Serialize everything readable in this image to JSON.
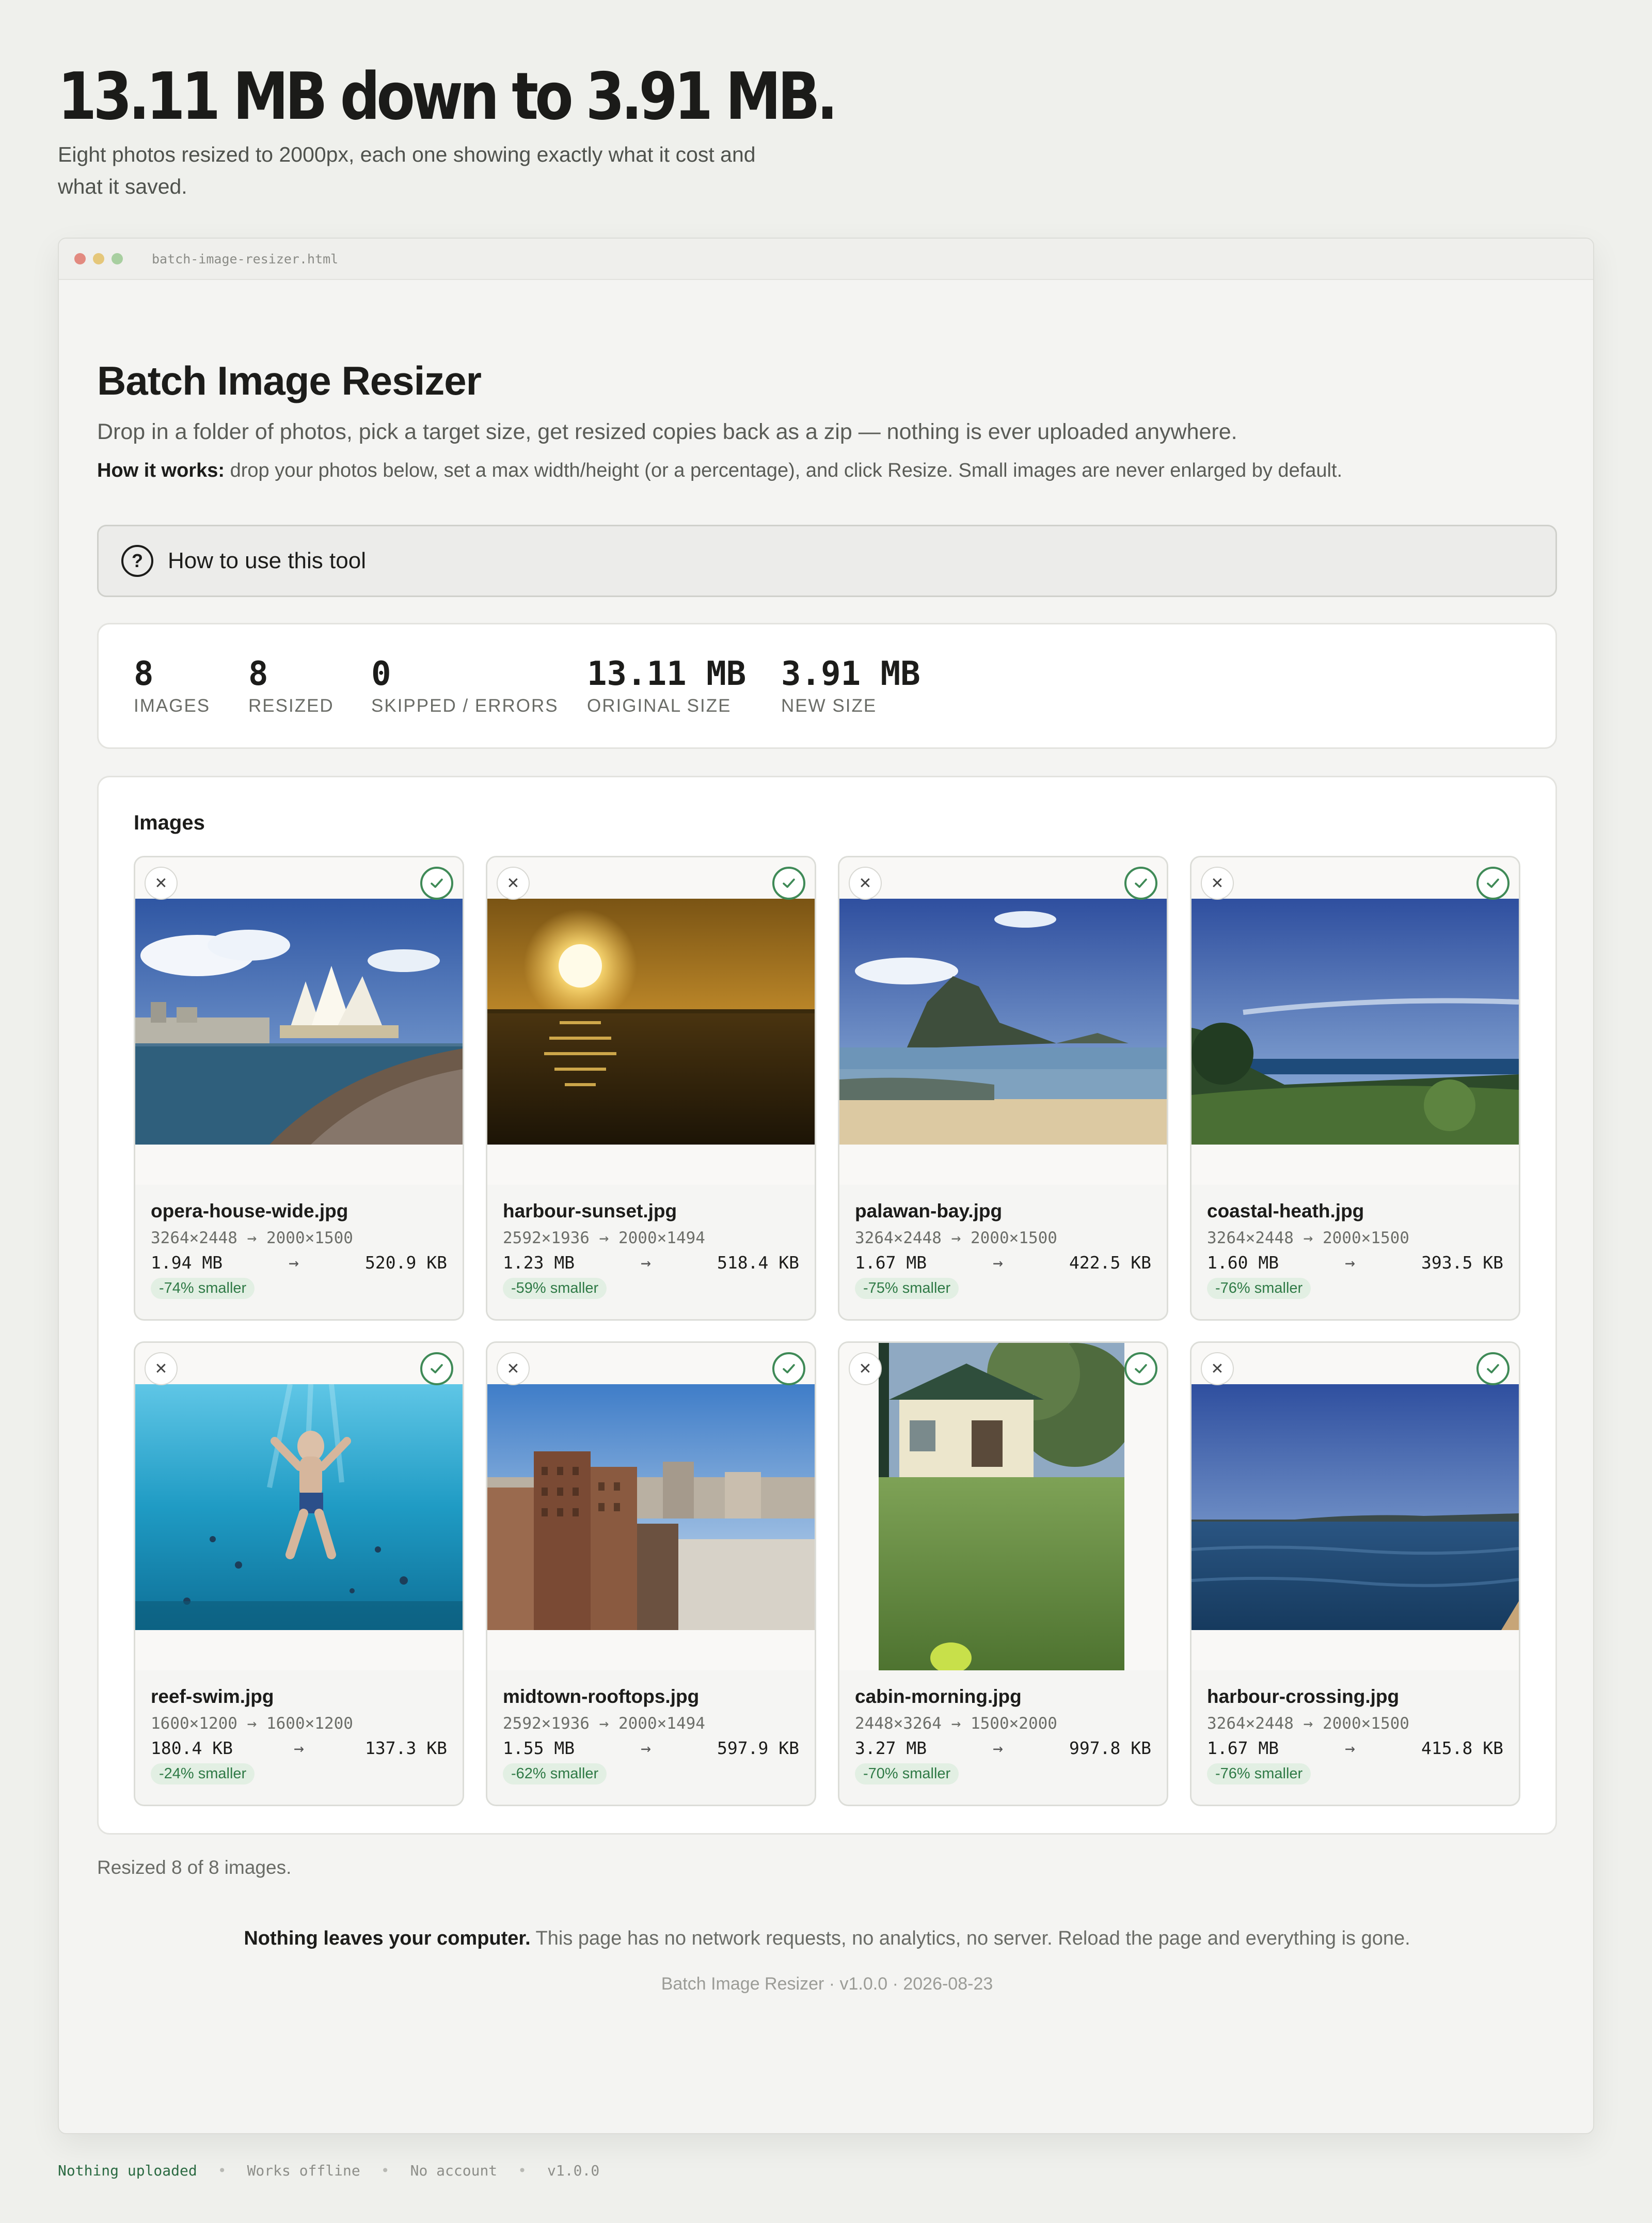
{
  "hero": {
    "title": "13.11 MB down to 3.91 MB.",
    "subtitle": "Eight photos resized to 2000px, each one showing exactly what it cost and what it saved."
  },
  "window": {
    "filename": "batch-image-resizer.html"
  },
  "app": {
    "title": "Batch Image Resizer",
    "description": "Drop in a folder of photos, pick a target size, get resized copies back as a zip — nothing is ever uploaded anywhere.",
    "how_label": "How it works:",
    "how_text": " drop your photos below, set a max width/height (or a percentage), and click Resize. Small images are never enlarged by default."
  },
  "howto": {
    "icon": "help-circle-icon",
    "label": "How to use this tool"
  },
  "stats": {
    "images": {
      "value": "8",
      "label": "IMAGES"
    },
    "resized": {
      "value": "8",
      "label": "RESIZED"
    },
    "skipped": {
      "value": "0",
      "label": "SKIPPED / ERRORS"
    },
    "original": {
      "value": "13.11 MB",
      "label": "ORIGINAL SIZE"
    },
    "new": {
      "value": "3.91 MB",
      "label": "NEW SIZE"
    }
  },
  "images_section": {
    "title": "Images",
    "cards": [
      {
        "name": "opera-house-wide.jpg",
        "dims": "3264×2448 → 2000×1500",
        "from": "1.94 MB",
        "arrow": "→",
        "to": "520.9 KB",
        "badge": "-74% smaller"
      },
      {
        "name": "harbour-sunset.jpg",
        "dims": "2592×1936 → 2000×1494",
        "from": "1.23 MB",
        "arrow": "→",
        "to": "518.4 KB",
        "badge": "-59% smaller"
      },
      {
        "name": "palawan-bay.jpg",
        "dims": "3264×2448 → 2000×1500",
        "from": "1.67 MB",
        "arrow": "→",
        "to": "422.5 KB",
        "badge": "-75% smaller"
      },
      {
        "name": "coastal-heath.jpg",
        "dims": "3264×2448 → 2000×1500",
        "from": "1.60 MB",
        "arrow": "→",
        "to": "393.5 KB",
        "badge": "-76% smaller"
      },
      {
        "name": "reef-swim.jpg",
        "dims": "1600×1200 → 1600×1200",
        "from": "180.4 KB",
        "arrow": "→",
        "to": "137.3 KB",
        "badge": "-24% smaller"
      },
      {
        "name": "midtown-rooftops.jpg",
        "dims": "2592×1936 → 2000×1494",
        "from": "1.55 MB",
        "arrow": "→",
        "to": "597.9 KB",
        "badge": "-62% smaller"
      },
      {
        "name": "cabin-morning.jpg",
        "dims": "2448×3264 → 1500×2000",
        "from": "3.27 MB",
        "arrow": "→",
        "to": "997.8 KB",
        "badge": "-70% smaller"
      },
      {
        "name": "harbour-crossing.jpg",
        "dims": "3264×2448 → 2000×1500",
        "from": "1.67 MB",
        "arrow": "→",
        "to": "415.8 KB",
        "badge": "-76% smaller"
      }
    ]
  },
  "status": {
    "resized_text": "Resized 8 of 8 images."
  },
  "privacy": {
    "bold": "Nothing leaves your computer.",
    "text": " This page has no network requests, no analytics, no server. Reload the page and everything is gone."
  },
  "version_line": "Batch Image Resizer · v1.0.0 · 2026-08-23",
  "footer": {
    "items": [
      "Nothing uploaded",
      "Works offline",
      "No account",
      "v1.0.0"
    ],
    "separator": "•"
  },
  "colors": {
    "accent_green": "#3f8a57",
    "badge_bg": "#e2efe3",
    "page_bg": "#eff0ec"
  }
}
